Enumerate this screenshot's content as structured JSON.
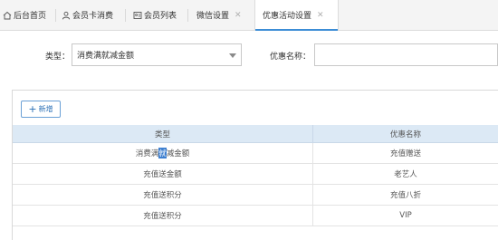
{
  "tabs": [
    {
      "label": "后台首页",
      "icon": "home-icon",
      "closable": false,
      "active": false
    },
    {
      "label": "会员卡消费",
      "icon": "user-icon",
      "closable": false,
      "active": false
    },
    {
      "label": "会员列表",
      "icon": "id-card-icon",
      "closable": false,
      "active": false
    },
    {
      "label": "微信设置",
      "icon": "",
      "closable": true,
      "active": false
    },
    {
      "label": "优惠活动设置",
      "icon": "",
      "closable": true,
      "active": true
    }
  ],
  "close_glyph": "✕",
  "search": {
    "type_label": "类型：",
    "type_value": "消费满就减金额",
    "name_label": "优惠名称：",
    "name_value": ""
  },
  "toolbar": {
    "add_label": "新增",
    "add_icon": "plus-icon"
  },
  "table": {
    "columns": [
      "类型",
      "优惠名称"
    ],
    "rows": [
      {
        "type_parts": [
          "消费满",
          "就",
          "减金额"
        ],
        "name": "充值赠送"
      },
      {
        "type": "充值送金额",
        "name": "老艺人"
      },
      {
        "type": "充值送积分",
        "name": "充值八折"
      },
      {
        "type": "充值送积分",
        "name": "VIP"
      }
    ]
  },
  "colors": {
    "accent": "#3c8dd6",
    "header_bg": "#dce9f5",
    "selection": "#3d7fd0"
  }
}
